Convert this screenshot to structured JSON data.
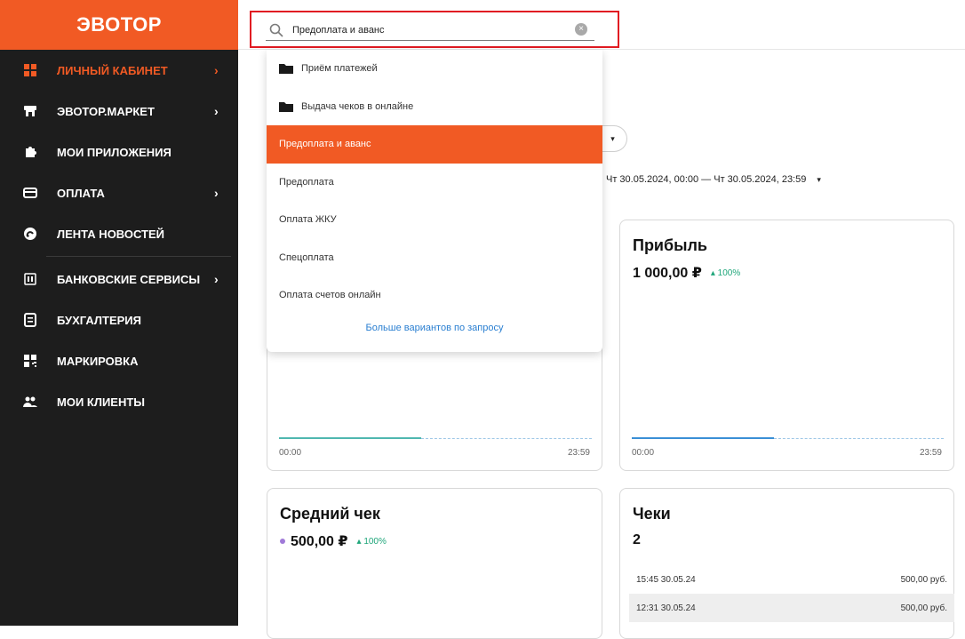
{
  "brand": {
    "name": "ЭВОТОР"
  },
  "sidebar": {
    "items": [
      {
        "label": "ЛИЧНЫЙ КАБИНЕТ",
        "icon": "grid-icon",
        "chevron": "›",
        "active": true
      },
      {
        "label": "ЭВОТОР.МАРКЕТ",
        "icon": "store-icon",
        "chevron": "›"
      },
      {
        "label": "МОИ ПРИЛОЖЕНИЯ",
        "icon": "puzzle-icon"
      },
      {
        "label": "ОПЛАТА",
        "icon": "card-icon",
        "chevron": "›"
      },
      {
        "label": "ЛЕНТА НОВОСТЕЙ",
        "icon": "news-icon"
      },
      {
        "label": "БАНКОВСКИЕ СЕРВИСЫ",
        "icon": "bank-icon",
        "chevron": "›"
      },
      {
        "label": "БУХГАЛТЕРИЯ",
        "icon": "ledger-icon"
      },
      {
        "label": "МАРКИРОВКА",
        "icon": "qr-icon"
      },
      {
        "label": "МОИ КЛИЕНТЫ",
        "icon": "users-icon"
      }
    ]
  },
  "search": {
    "value": "Предоплата и аванс",
    "clear_icon": "×"
  },
  "dropdown": {
    "items": [
      {
        "label": "Приём платежей",
        "folder": true
      },
      {
        "label": "Выдача чеков в онлайне",
        "folder": true
      },
      {
        "label": "Предоплата и аванс",
        "highlighted": true
      },
      {
        "label": "Предоплата"
      },
      {
        "label": "Оплата ЖКУ"
      },
      {
        "label": "Спецоплата"
      },
      {
        "label": "Оплата счетов онлайн"
      }
    ],
    "more_link": "Больше вариантов по запросу"
  },
  "filters": {
    "toggle_icon": "▾",
    "date_range": "Чт 30.05.2024, 00:00 — Чт 30.05.2024, 23:59",
    "date_caret": "▾"
  },
  "cards": {
    "left_chart": {
      "axis_start": "00:00",
      "axis_end": "23:59"
    },
    "profit": {
      "title": "Прибыль",
      "value": "1 000,00 ₽",
      "delta": "▴ 100%",
      "axis_start": "00:00",
      "axis_end": "23:59"
    },
    "average_check": {
      "title": "Средний чек",
      "value": "500,00 ₽",
      "delta": "▴ 100%"
    },
    "checks": {
      "title": "Чеки",
      "count": "2",
      "rows": [
        {
          "time": "15:45 30.05.24",
          "amount": "500,00 руб."
        },
        {
          "time": "12:31 30.05.24",
          "amount": "500,00 руб."
        }
      ]
    }
  },
  "colors": {
    "brand": "#f15a24",
    "sidebar_bg": "#1d1d1d",
    "positive": "#1fa67a",
    "link": "#2a7fd1",
    "highlight_border": "#e11b22"
  }
}
